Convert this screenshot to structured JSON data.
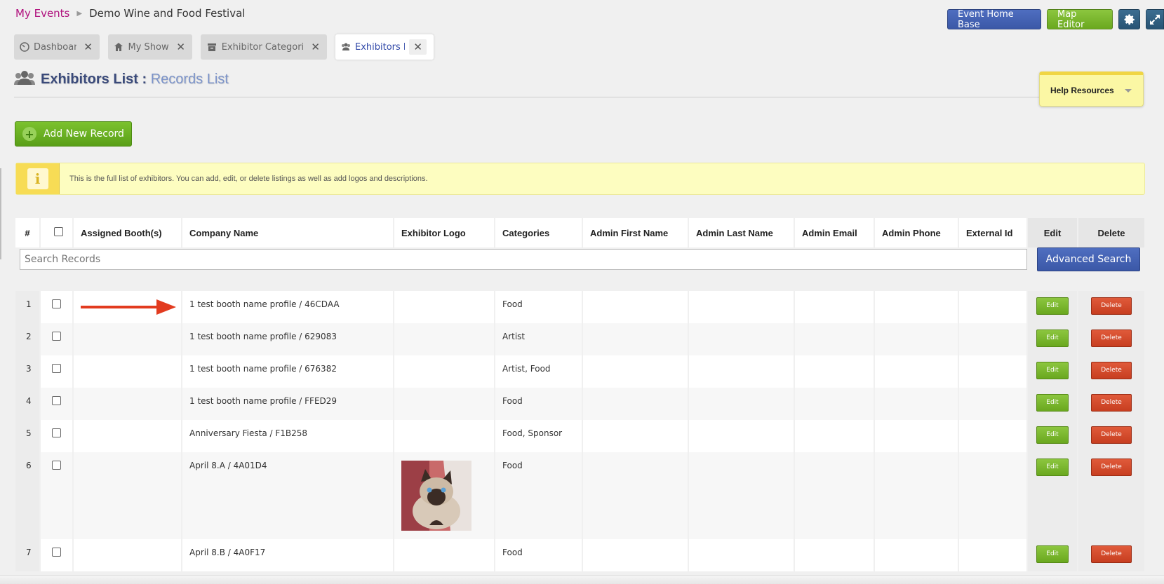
{
  "breadcrumb": {
    "link": "My Events",
    "current": "Demo Wine and Food Festival"
  },
  "top_actions": {
    "event_home_base": "Event Home Base",
    "map_editor": "Map Editor"
  },
  "tabs": [
    {
      "label": "Dashboard",
      "icon": "dashboard-icon",
      "active": false
    },
    {
      "label": "My Shows",
      "icon": "home-icon",
      "active": false
    },
    {
      "label": "Exhibitor Categories",
      "icon": "archive-icon",
      "active": false
    },
    {
      "label": "Exhibitors List",
      "icon": "users-icon",
      "active": true
    }
  ],
  "page": {
    "title": "Exhibitors List :",
    "subtitle": "Records List"
  },
  "help": {
    "label": "Help Resources"
  },
  "add_button": {
    "label": "Add New Record"
  },
  "info": {
    "text": "This is the full list of exhibitors. You can add, edit, or delete listings as well as add logos and descriptions."
  },
  "table": {
    "headers": {
      "num": "#",
      "booths": "Assigned Booth(s)",
      "company": "Company Name",
      "logo": "Exhibitor Logo",
      "categories": "Categories",
      "first": "Admin First Name",
      "last": "Admin Last Name",
      "email": "Admin Email",
      "phone": "Admin Phone",
      "external": "External Id",
      "edit": "Edit",
      "delete": "Delete"
    },
    "search": {
      "placeholder": "Search Records",
      "advanced": "Advanced Search"
    },
    "edit_label": "Edit",
    "delete_label": "Delete",
    "rows": [
      {
        "num": "1",
        "company": "1 test booth name profile / 46CDAA",
        "categories": "Food"
      },
      {
        "num": "2",
        "company": "1 test booth name profile / 629083",
        "categories": "Artist"
      },
      {
        "num": "3",
        "company": "1 test booth name profile / 676382",
        "categories": "Artist, Food"
      },
      {
        "num": "4",
        "company": "1 test booth name profile / FFED29",
        "categories": "Food"
      },
      {
        "num": "5",
        "company": "Anniversary Fiesta / F1B258",
        "categories": "Food, Sponsor"
      },
      {
        "num": "6",
        "company": "April 8.A / 4A01D4",
        "categories": "Food"
      },
      {
        "num": "7",
        "company": "April 8.B / 4A0F17",
        "categories": "Food"
      }
    ]
  },
  "colors": {
    "breadcrumb_link": "#b0127e",
    "accent_blue": "#3b58a7",
    "accent_green": "#6aa81f",
    "delete_red": "#c73e20",
    "arrow": "#e23b1f"
  }
}
